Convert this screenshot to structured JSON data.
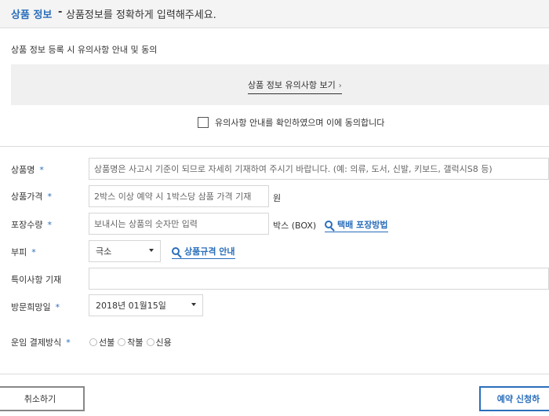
{
  "header": {
    "title": "상품 정보",
    "separator": "-",
    "description": "상품정보를 정확하게 입력해주세요."
  },
  "notice": {
    "title": "상품 정보 등록 시 유의사항 안내 및 동의",
    "link_label": "상품 정보 유의사항 보기",
    "link_chevron": "›",
    "agree_label": "유의사항 안내를 확인하였으며 이에 동의합니다"
  },
  "form": {
    "required_mark": "*",
    "product_name": {
      "label": "상품명",
      "placeholder": "상품명은 사고시 기준이 되므로 자세히 기재하여 주시기 바랍니다. (예: 의류, 도서, 신발, 키보드, 갤럭시S8 등)"
    },
    "price": {
      "label": "상품가격",
      "placeholder": "2박스 이상 예약 시 1박스당 삼품 가격 기재",
      "unit": "원"
    },
    "quantity": {
      "label": "포장수량",
      "placeholder": "보내시는 상품의 숫자만 입력",
      "unit": "박스 (BOX)",
      "help_link": "택배 포장방법"
    },
    "volume": {
      "label": "부피",
      "selected": "극소",
      "help_link": "상품규격 안내"
    },
    "notes": {
      "label": "특이사항 기재",
      "value": ""
    },
    "visit_date": {
      "label": "방문희망일",
      "selected": "2018년 01월15일"
    },
    "payment": {
      "label": "운임 결제방식",
      "options": [
        "선불",
        "착불",
        "신용"
      ]
    }
  },
  "actions": {
    "cancel_label": "취소하기",
    "submit_label": "예약 신청하"
  },
  "colors": {
    "accent": "#2a6ebb",
    "notice_bg": "#f0f0f0",
    "header_bg": "#f4f4f4"
  }
}
